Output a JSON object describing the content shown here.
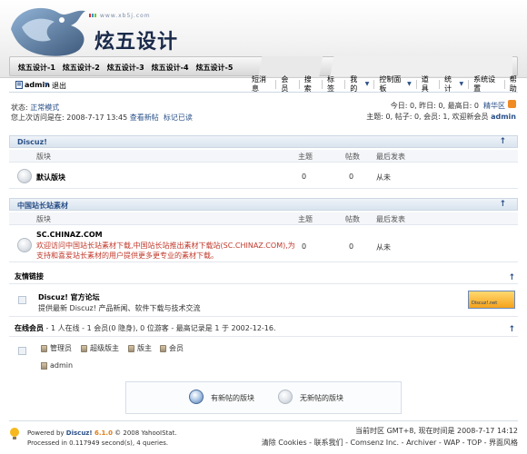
{
  "header": {
    "site_title": "炫五设计",
    "url_text": "www.xb5j.com",
    "tabs": [
      "炫五设计-1",
      "炫五设计-2",
      "炫五设计-3",
      "炫五设计-4",
      "炫五设计-5"
    ]
  },
  "userbar": {
    "username": "admin",
    "logout": "退出",
    "menu": [
      {
        "label": "短消息",
        "dropdown": false
      },
      {
        "label": "会员",
        "dropdown": false
      },
      {
        "label": "搜索",
        "dropdown": false
      },
      {
        "label": "标签",
        "dropdown": false
      },
      {
        "label": "我的",
        "dropdown": true
      },
      {
        "label": "控制面板",
        "dropdown": true
      },
      {
        "label": "道具",
        "dropdown": false
      },
      {
        "label": "统计",
        "dropdown": true
      },
      {
        "label": "系统设置",
        "dropdown": false
      },
      {
        "label": "帮助",
        "dropdown": false
      }
    ]
  },
  "status": {
    "status_prefix": "状态: ",
    "status_mode": "正常模式",
    "lastvisit_prefix": "您上次访问是在: 2008-7-17 13:45",
    "view_new": "查看新帖",
    "mark_read": "标记已读",
    "stats_today": "今日: 0, 昨日: 0, 最高日: 0",
    "stats_link": "精华区",
    "stats_totals": "主题: 0, 帖子: 0, 会员: 1, 欢迎新会员",
    "new_member": "admin"
  },
  "categories": [
    {
      "title": "Discuz!",
      "columns": {
        "forum": "版块",
        "topics": "主题",
        "posts": "帖数",
        "last": "最后发表"
      },
      "forums": [
        {
          "name": "默认版块",
          "description": "",
          "topics": "0",
          "posts": "0",
          "last": "从未"
        }
      ]
    },
    {
      "title": "中国站长站素材",
      "columns": {
        "forum": "版块",
        "topics": "主题",
        "posts": "帖数",
        "last": "最后发表"
      },
      "forums": [
        {
          "name": "SC.CHINAZ.COM",
          "description": "欢迎访问中国站长站素材下载,中国站长站推出素材下载站(SC.CHINAZ.COM),为支持和喜爱站长素材的用户提供更多更专业的素材下载。",
          "topics": "0",
          "posts": "0",
          "last": "从未"
        }
      ]
    }
  ],
  "links": {
    "title": "友情链接",
    "name": "Discuz! 官方论坛",
    "description": "提供最新 Discuz! 产品新闻、软件下载与技术交流",
    "badge": "Discuz!.net"
  },
  "online": {
    "title": "在线会员",
    "summary": " - 1 人在线 - 1 会员(0 隐身), 0 位游客 - 最高记录是 1 于 2002-12-16.",
    "legend": [
      "管理员",
      "超级版主",
      "版主",
      "会员"
    ],
    "users": [
      "admin"
    ]
  },
  "legend": {
    "new": "有新帖的版块",
    "old": "无新帖的版块"
  },
  "footer": {
    "powered_prefix": "Powered by ",
    "powered_name": "Discuz!",
    "powered_version": " 6.1.0",
    "powered_suffix": " © 2008 YahooIStat.",
    "processed": "Processed in 0.117949 second(s), 4 queries.",
    "time": "当前时区 GMT+8, 现在时间是 2008-7-17 14:12",
    "links": "清除 Cookies - 联系我们 - Comsenz Inc. - Archiver - WAP - TOP - 界面风格"
  },
  "colors": {
    "accent": "#2a5088",
    "forum_desc": "#c0392b",
    "header_bg": "#eef3f8"
  }
}
